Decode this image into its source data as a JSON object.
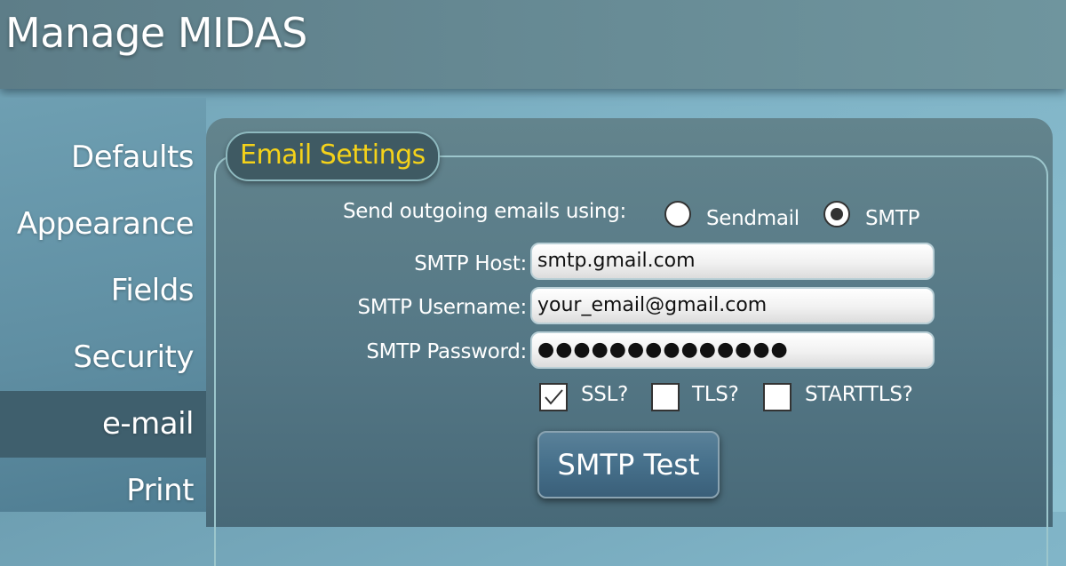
{
  "header": {
    "title": "Manage MIDAS"
  },
  "sidebar": {
    "items": [
      {
        "label": "Defaults",
        "active": false
      },
      {
        "label": "Appearance",
        "active": false
      },
      {
        "label": "Fields",
        "active": false
      },
      {
        "label": "Security",
        "active": false
      },
      {
        "label": "e-mail",
        "active": true
      },
      {
        "label": "Print",
        "active": false
      }
    ]
  },
  "email_settings": {
    "title": "Email Settings",
    "send_using_label": "Send outgoing emails using:",
    "send_options": [
      {
        "label": "Sendmail",
        "selected": false
      },
      {
        "label": "SMTP",
        "selected": true
      }
    ],
    "smtp_host": {
      "label": "SMTP Host:",
      "value": "smtp.gmail.com"
    },
    "smtp_username": {
      "label": "SMTP Username:",
      "value": "your_email@gmail.com"
    },
    "smtp_password": {
      "label": "SMTP Password:",
      "value": "●●●●●●●●●●●●●●"
    },
    "security": [
      {
        "label": "SSL?",
        "checked": true
      },
      {
        "label": "TLS?",
        "checked": false
      },
      {
        "label": "STARTTLS?",
        "checked": false
      }
    ],
    "test_button": "SMTP Test"
  },
  "colors": {
    "accent_title": "#f4d21a",
    "active_nav": "#3f5f6d"
  }
}
